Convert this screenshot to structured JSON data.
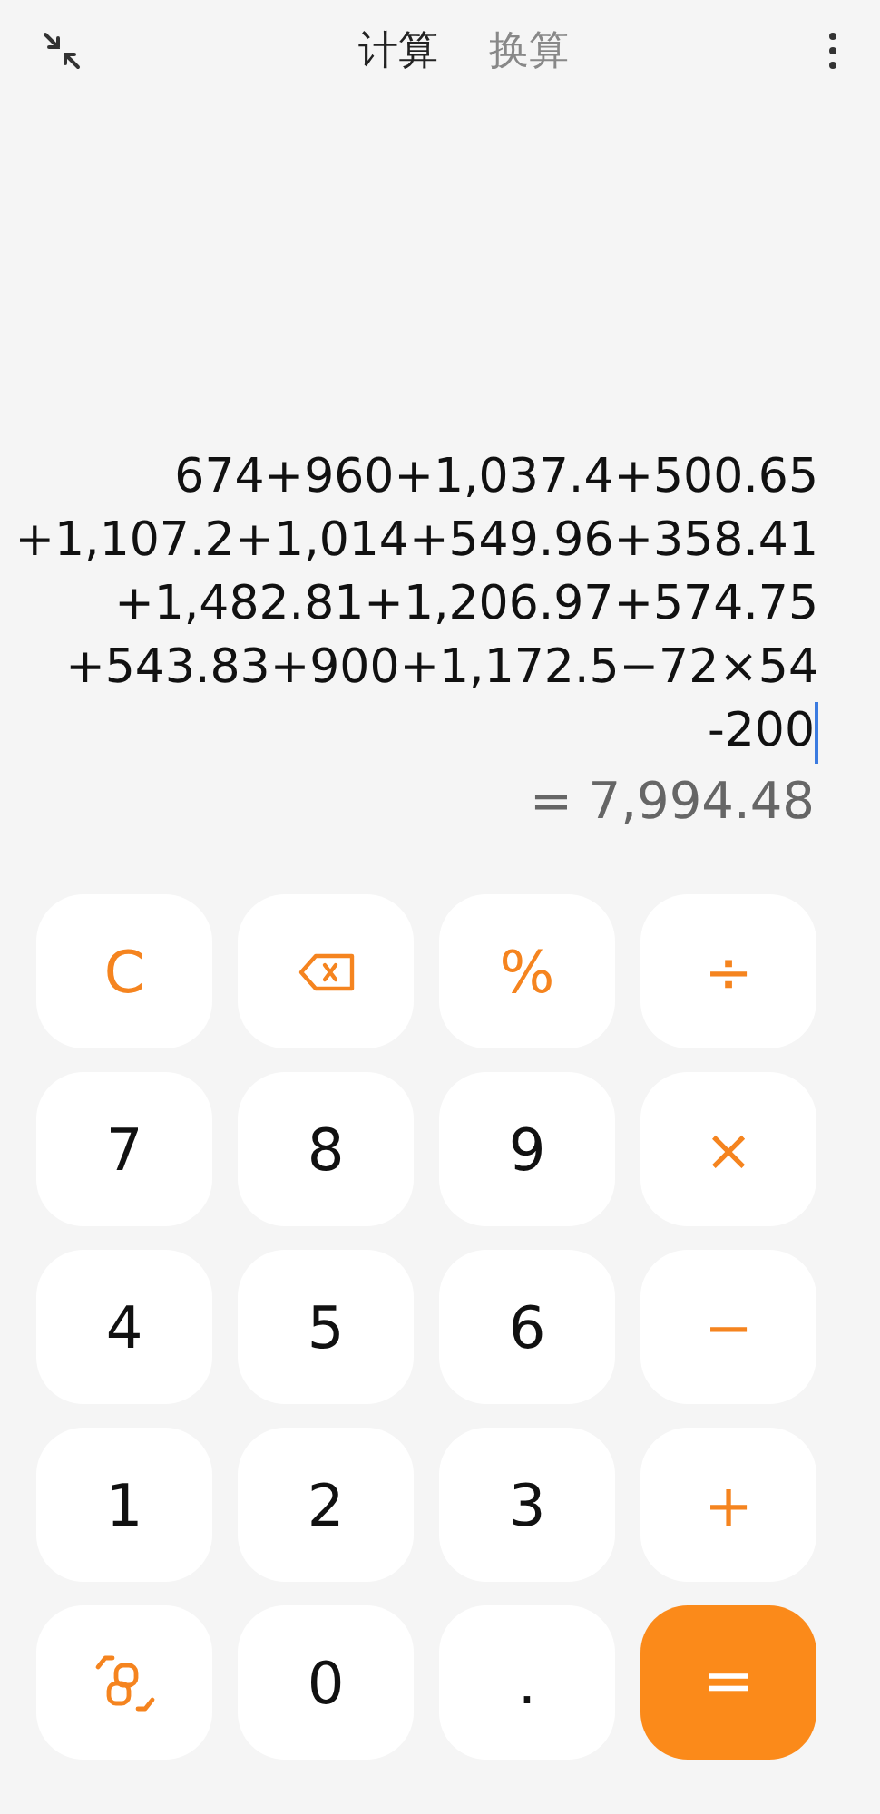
{
  "tabs": [
    {
      "label": "计算",
      "selected": true
    },
    {
      "label": "换算",
      "selected": false
    }
  ],
  "expression_lines": [
    "674+960+1,037.4+500.65",
    "+1,107.2+1,014+549.96+358.41",
    "+1,482.81+1,206.97+574.75",
    "+543.83+900+1,172.5−72×54",
    "-200"
  ],
  "result": "= 7,994.48",
  "keys": [
    {
      "kind": "operator",
      "label": "C"
    },
    {
      "kind": "backspace"
    },
    {
      "kind": "operator",
      "label": "%"
    },
    {
      "kind": "operator",
      "label": "÷"
    },
    {
      "kind": "digit",
      "label": "7"
    },
    {
      "kind": "digit",
      "label": "8"
    },
    {
      "kind": "digit",
      "label": "9"
    },
    {
      "kind": "operator",
      "label": "×"
    },
    {
      "kind": "digit",
      "label": "4"
    },
    {
      "kind": "digit",
      "label": "5"
    },
    {
      "kind": "digit",
      "label": "6"
    },
    {
      "kind": "operator",
      "label": "−"
    },
    {
      "kind": "digit",
      "label": "1"
    },
    {
      "kind": "digit",
      "label": "2"
    },
    {
      "kind": "digit",
      "label": "3"
    },
    {
      "kind": "operator",
      "label": "+"
    },
    {
      "kind": "swap"
    },
    {
      "kind": "digit",
      "label": "0"
    },
    {
      "kind": "digit",
      "label": "."
    },
    {
      "kind": "equals",
      "label": "="
    }
  ]
}
